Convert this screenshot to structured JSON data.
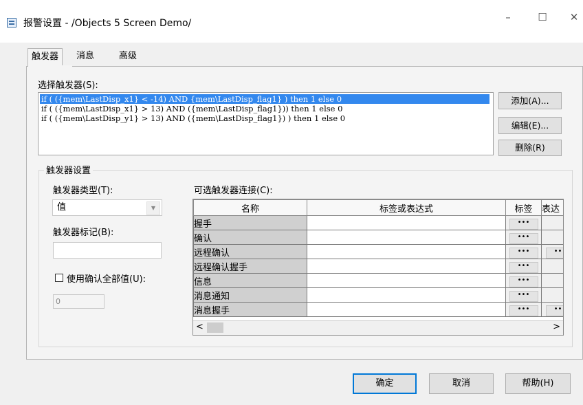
{
  "window": {
    "title": "报警设置 - /Objects 5 Screen Demo/",
    "min_glyph": "–",
    "max_glyph": "☐",
    "close_glyph": "✕"
  },
  "tabs": [
    {
      "label": "触发器",
      "active": true
    },
    {
      "label": "消息",
      "active": false
    },
    {
      "label": "高级",
      "active": false
    }
  ],
  "triggers": {
    "label": "选择触发器(S):",
    "items": [
      "if ( ({mem\\LastDisp_x1} < -14) AND {mem\\LastDisp_flag1} ) then 1 else 0",
      "if ( ({mem\\LastDisp_x1} > 13) AND ({mem\\LastDisp_flag1})) then 1 else 0",
      "if ( ({mem\\LastDisp_y1} > 13) AND ({mem\\LastDisp_flag1}) ) then 1 else 0"
    ],
    "selected_index": 0,
    "add_label": "添加(A)...",
    "edit_label": "编辑(E)...",
    "delete_label": "删除(R)"
  },
  "settings": {
    "group_title": "触发器设置",
    "type_label": "触发器类型(T):",
    "type_value": "值",
    "tag_label": "触发器标记(B):",
    "tag_value": "",
    "use_ack_all_label": "使用确认全部值(U):",
    "use_ack_all_checked": false,
    "ack_all_value": "0"
  },
  "connections": {
    "label": "可选触发器连接(C):",
    "columns": [
      "名称",
      "标签或表达式",
      "标签",
      "表达"
    ],
    "rows": [
      {
        "name": "握手",
        "expr": "",
        "tag_btn": "•••",
        "expr_btn": ""
      },
      {
        "name": "确认",
        "expr": "",
        "tag_btn": "•••",
        "expr_btn": ""
      },
      {
        "name": "远程确认",
        "expr": "",
        "tag_btn": "•••",
        "expr_btn": "•••"
      },
      {
        "name": "远程确认握手",
        "expr": "",
        "tag_btn": "•••",
        "expr_btn": ""
      },
      {
        "name": "信息",
        "expr": "",
        "tag_btn": "•••",
        "expr_btn": ""
      },
      {
        "name": "消息通知",
        "expr": "",
        "tag_btn": "•••",
        "expr_btn": ""
      },
      {
        "name": "消息握手",
        "expr": "",
        "tag_btn": "•••",
        "expr_btn": "•••"
      }
    ],
    "scroll_left": "<",
    "scroll_right": ">"
  },
  "footer": {
    "ok_label": "确定",
    "cancel_label": "取消",
    "help_label": "帮助(H)"
  }
}
